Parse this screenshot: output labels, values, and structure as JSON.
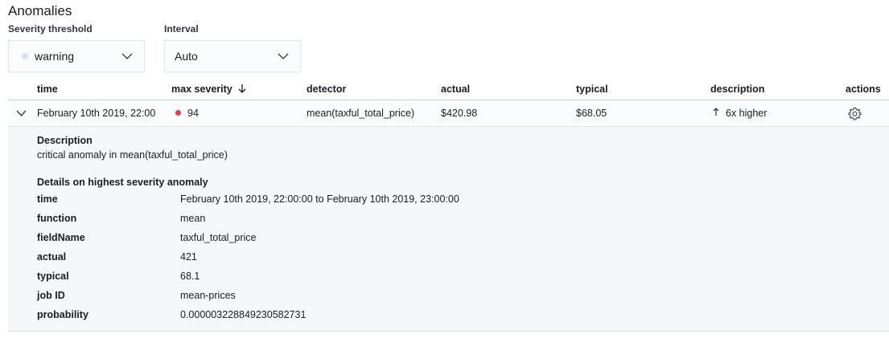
{
  "header": {
    "title": "Anomalies"
  },
  "controls": {
    "severity_label": "Severity threshold",
    "severity_value": "warning",
    "interval_label": "Interval",
    "interval_value": "Auto"
  },
  "table": {
    "columns": [
      "time",
      "max severity",
      "detector",
      "actual",
      "typical",
      "description",
      "actions"
    ],
    "sort_indicator": "arrow-down-icon",
    "row": {
      "time": "February 10th 2019, 22:00",
      "severity": "94",
      "detector": "mean(taxful_total_price)",
      "actual": "$420.98",
      "typical": "$68.05",
      "description": "6x higher"
    }
  },
  "expanded": {
    "description_heading": "Description",
    "description_text": "critical anomaly in mean(taxful_total_price)",
    "details_heading": "Details on highest severity anomaly",
    "details": [
      {
        "label": "time",
        "value": "February 10th 2019, 22:00:00 to February 10th 2019, 23:00:00"
      },
      {
        "label": "function",
        "value": "mean"
      },
      {
        "label": "fieldName",
        "value": "taxful_total_price"
      },
      {
        "label": "actual",
        "value": "421"
      },
      {
        "label": "typical",
        "value": "68.1"
      },
      {
        "label": "job ID",
        "value": "mean-prices"
      },
      {
        "label": "probability",
        "value": "0.000003228849230582731"
      }
    ]
  },
  "colors": {
    "severity_critical": "#e7404a",
    "severity_warning": "#cde3f6",
    "accent": "#006bb4"
  }
}
